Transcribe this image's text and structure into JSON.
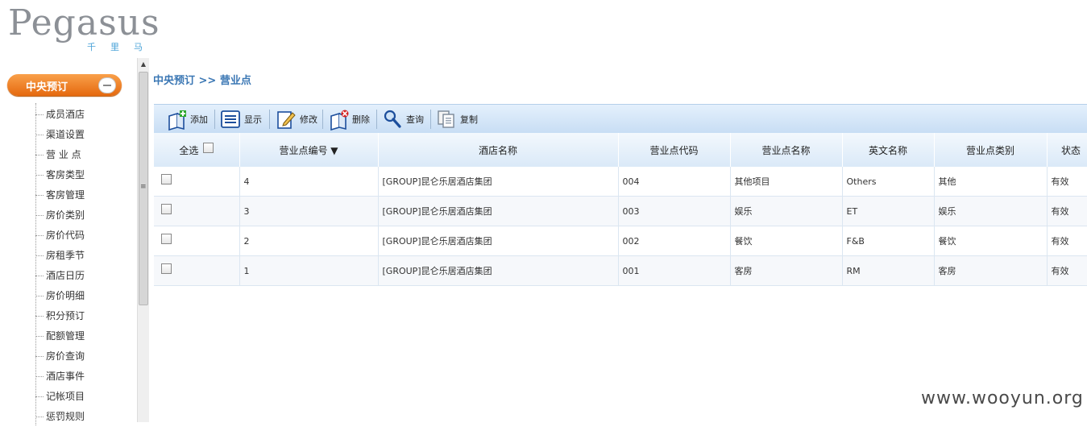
{
  "logo": {
    "word": "Pegasus",
    "sub": "千里马"
  },
  "sidebar": {
    "header": "中央预订",
    "items": [
      "成员酒店",
      "渠道设置",
      "营 业 点",
      "客房类型",
      "客房管理",
      "房价类别",
      "房价代码",
      "房租季节",
      "酒店日历",
      "房价明细",
      "积分预订",
      "配额管理",
      "房价查询",
      "酒店事件",
      "记帐项目",
      "惩罚规则"
    ]
  },
  "breadcrumb": "中央预订 >> 营业点",
  "toolbar": {
    "add": "添加",
    "view": "显示",
    "edit": "修改",
    "delete": "删除",
    "query": "查询",
    "copy": "复制"
  },
  "table": {
    "select_all": "全选",
    "headers": [
      "营业点编号 ▼",
      "酒店名称",
      "营业点代码",
      "营业点名称",
      "英文名称",
      "营业点类别",
      "状态"
    ],
    "rows": [
      [
        "4",
        "[GROUP]昆仑乐居酒店集团",
        "004",
        "其他项目",
        "Others",
        "其他",
        "有效"
      ],
      [
        "3",
        "[GROUP]昆仑乐居酒店集团",
        "003",
        "娱乐",
        "ET",
        "娱乐",
        "有效"
      ],
      [
        "2",
        "[GROUP]昆仑乐居酒店集团",
        "002",
        "餐饮",
        "F&B",
        "餐饮",
        "有效"
      ],
      [
        "1",
        "[GROUP]昆仑乐居酒店集团",
        "001",
        "客房",
        "RM",
        "客房",
        "有效"
      ]
    ]
  },
  "watermark": "www.wooyun.org",
  "colors": {
    "accent": "#3b77b4",
    "menu_header": "#e5690e",
    "toolbar": "#c7ddf4"
  }
}
